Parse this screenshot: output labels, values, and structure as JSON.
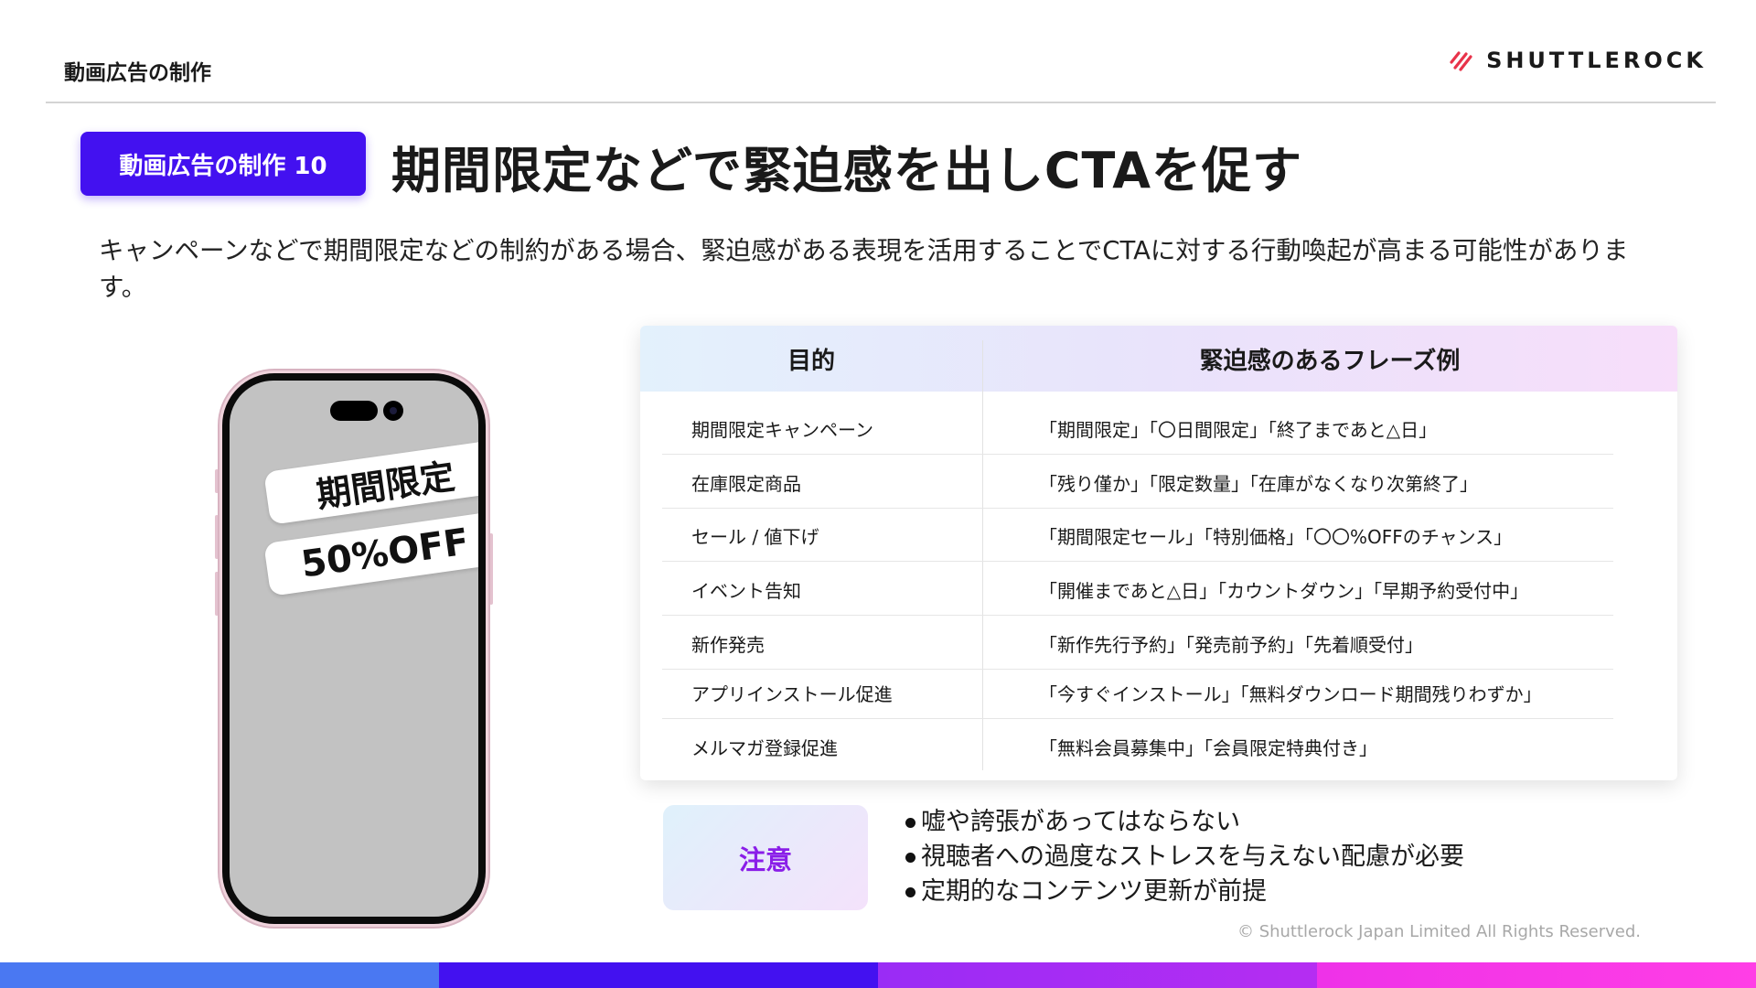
{
  "header": {
    "section_title": "動画広告の制作",
    "logo_text": "SHUTTLEROCK",
    "logo_icon": "slash-stripes-icon"
  },
  "badge": {
    "label": "動画広告の制作 10"
  },
  "title": "期間限定などで緊迫感を出しCTAを促す",
  "description": "キャンペーンなどで期間限定などの制約がある場合、緊迫感がある表現を活用することでCTAに対する行動喚起が高まる可能性があります。",
  "phone": {
    "tag1": "期間限定",
    "tag2": "50%OFF"
  },
  "table": {
    "headers": [
      "目的",
      "緊迫感のあるフレーズ例"
    ],
    "rows": [
      {
        "purpose": "期間限定キャンペーン",
        "phrases": "「期間限定」「〇日間限定」「終了まであと△日」"
      },
      {
        "purpose": "在庫限定商品",
        "phrases": "「残り僅か」「限定数量」「在庫がなくなり次第終了」"
      },
      {
        "purpose": "セール / 値下げ",
        "phrases": "「期間限定セール」「特別価格」「〇〇%OFFのチャンス」"
      },
      {
        "purpose": "イベント告知",
        "phrases": "「開催まであと△日」「カウントダウン」「早期予約受付中」"
      },
      {
        "purpose": "新作発売",
        "phrases": "「新作先行予約」「発売前予約」「先着順受付」"
      },
      {
        "purpose": "アプリインストール促進",
        "phrases": "「今すぐインストール」「無料ダウンロード期間残りわずか」"
      },
      {
        "purpose": "メルマガ登録促進",
        "phrases": "「無料会員募集中」「会員限定特典付き」"
      }
    ]
  },
  "caution": {
    "label": "注意",
    "notes": [
      "嘘や誇張があってはならない",
      "視聴者への過度なストレスを与えない配慮が必要",
      "定期的なコンテンツ更新が前提"
    ]
  },
  "footer": {
    "copyright": "© Shuttlerock Japan Limited All Rights Reserved."
  },
  "colors": {
    "badge": "#4311f0",
    "caution_text": "#8a1ee8",
    "logo_accent": "#e8334a"
  }
}
